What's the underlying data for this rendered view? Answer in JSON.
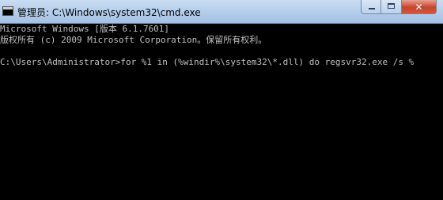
{
  "window": {
    "title": "管理员: C:\\Windows\\system32\\cmd.exe",
    "icon": "cmd-icon",
    "buttons": {
      "minimize_icon": "minimize-icon",
      "maximize_icon": "maximize-icon",
      "close_label": "✕"
    }
  },
  "console": {
    "lines": [
      "Microsoft Windows [版本 6.1.7601]",
      "版权所有 (c) 2009 Microsoft Corporation。保留所有权利。",
      "",
      "C:\\Users\\Administrator>for %1 in (%windir%\\system32\\*.dll) do regsvr32.exe /s %"
    ],
    "text_color": "#c0c0c0",
    "background": "#000000"
  }
}
